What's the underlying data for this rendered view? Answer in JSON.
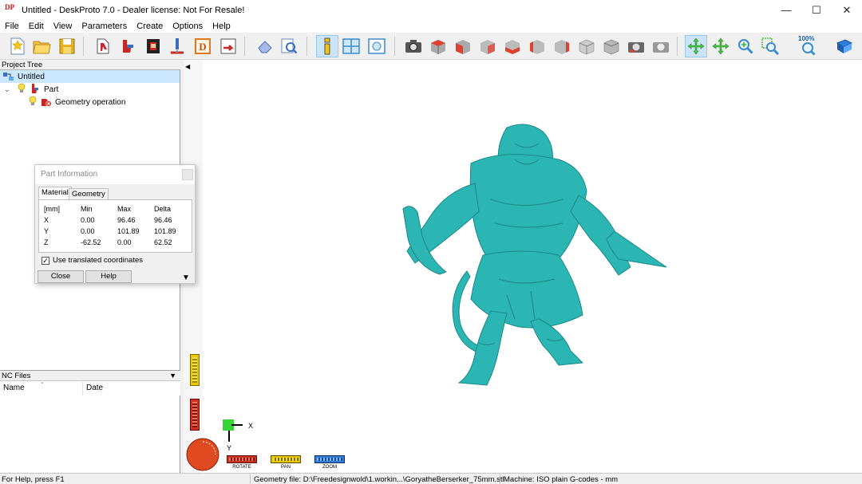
{
  "window": {
    "app_icon": "DP",
    "title": "Untitled - DeskProto 7.0 - Dealer license: Not For Resale!",
    "minimize": "—",
    "maximize": "☐",
    "close": "✕"
  },
  "menu": [
    "File",
    "Edit",
    "View",
    "Parameters",
    "Create",
    "Options",
    "Help"
  ],
  "toolbar": {
    "zoom_percent": "100%",
    "active_tool": "info-icon",
    "accent": "#5fbfe0"
  },
  "project_tree": {
    "header": "Project Tree",
    "items": [
      {
        "label": "Untitled",
        "icon": "project-icon",
        "selected": true
      },
      {
        "label": "Part",
        "icon": "part-icon",
        "expanded": true
      },
      {
        "label": "Geometry operation",
        "icon": "geometry-operation-icon"
      }
    ]
  },
  "nc_files": {
    "header": "NC Files",
    "columns": [
      "Name",
      "Date"
    ]
  },
  "dialog": {
    "title": "Part Information",
    "tabs": [
      "Material",
      "Geometry"
    ],
    "active_tab": "Material",
    "table": {
      "header": [
        "[mm]",
        "Min",
        "Max",
        "Delta"
      ],
      "rows": [
        [
          "X",
          "0.00",
          "96.46",
          "96.46"
        ],
        [
          "Y",
          "0.00",
          "101.89",
          "101.89"
        ],
        [
          "Z",
          "-62.52",
          "0.00",
          "62.52"
        ]
      ]
    },
    "checkbox_label": "Use translated coordinates",
    "checkbox_checked": true,
    "close_button": "Close",
    "help_button": "Help"
  },
  "view_controls": {
    "rotate": "ROTATE",
    "pan": "PAN",
    "zoom": "ZOOM",
    "axis_x": "X",
    "axis_y": "Y"
  },
  "model": {
    "color": "#2bb5b3"
  },
  "statusbar": {
    "help": "For Help, press F1",
    "geometry_file": "Geometry file: D:\\Freedesignwold\\1.workin...\\GoryatheBerserker_75mm.stl",
    "machine": "Machine: ISO plain G-codes - mm"
  }
}
